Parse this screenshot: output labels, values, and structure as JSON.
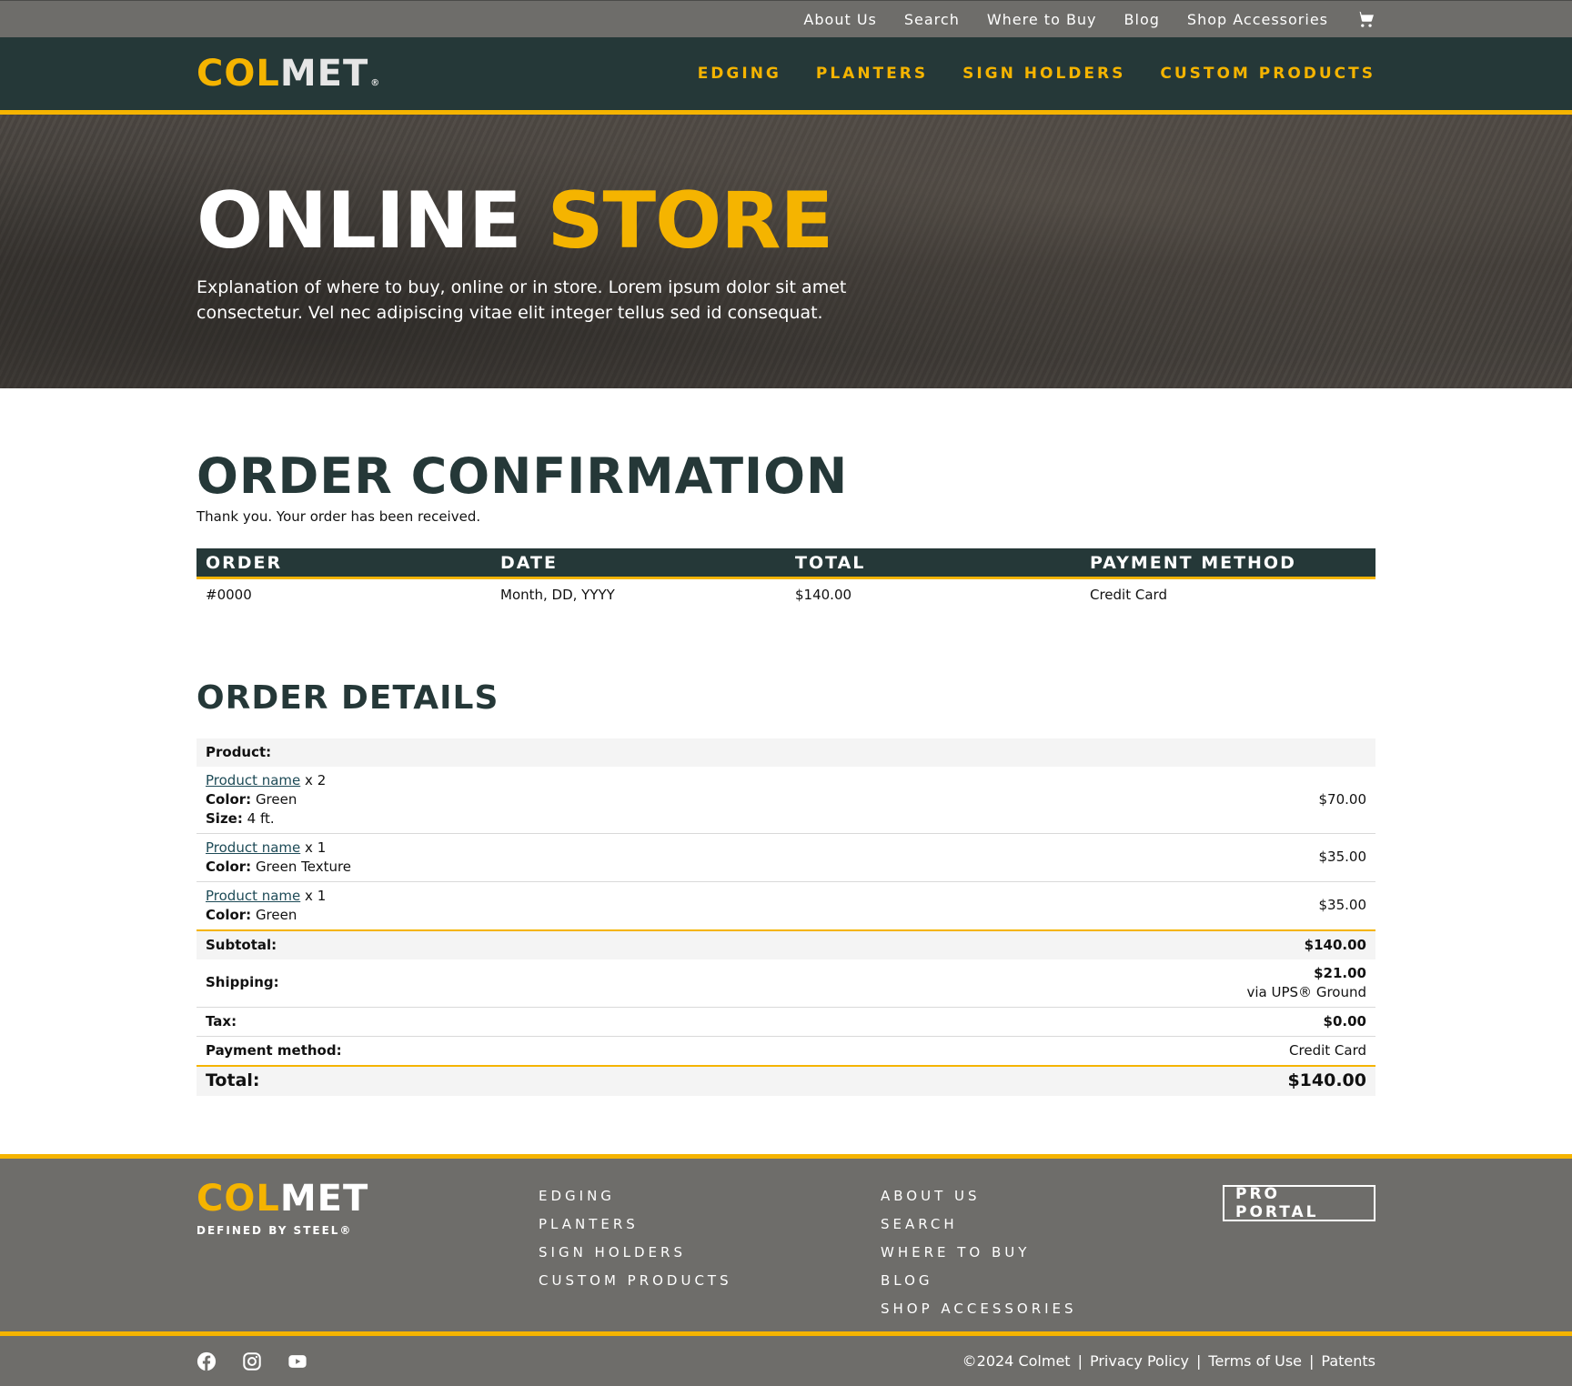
{
  "utility_nav": {
    "items": [
      "About Us",
      "Search",
      "Where to Buy",
      "Blog",
      "Shop Accessories"
    ],
    "cart_icon": "cart-icon"
  },
  "brand": {
    "logo_part1": "COL",
    "logo_part2": "MET",
    "logo_reg": "®",
    "tagline": "DEFINED BY STEEL®",
    "colors": {
      "dark": "#253838",
      "accent": "#f5b400",
      "gray": "#6e6d6a"
    }
  },
  "main_nav": {
    "items": [
      "EDGING",
      "PLANTERS",
      "SIGN HOLDERS",
      "CUSTOM PRODUCTS"
    ]
  },
  "hero": {
    "title_part1": "ONLINE",
    "title_part2": "STORE",
    "subtitle": "Explanation of where to buy, online or in store. Lorem ipsum dolor sit amet consectetur. Vel nec adipiscing vitae elit integer tellus sed id consequat."
  },
  "confirmation": {
    "title": "ORDER CONFIRMATION",
    "thanks": "Thank you. Your order has been received.",
    "columns": [
      "ORDER",
      "DATE",
      "TOTAL",
      "PAYMENT METHOD"
    ],
    "values": [
      "#0000",
      "Month, DD, YYYY",
      "$140.00",
      "Credit Card"
    ]
  },
  "details": {
    "title": "ORDER DETAILS",
    "product_header": "Product:",
    "items": [
      {
        "name": "Product name",
        "qty": "x 2",
        "color_label": "Color:",
        "color": "Green",
        "size_label": "Size:",
        "size": "4 ft.",
        "price": "$70.00"
      },
      {
        "name": "Product name",
        "qty": "x 1",
        "color_label": "Color:",
        "color": "Green Texture",
        "price": "$35.00"
      },
      {
        "name": "Product name",
        "qty": "x 1",
        "color_label": "Color:",
        "color": "Green",
        "price": "$35.00"
      }
    ],
    "subtotal_label": "Subtotal:",
    "subtotal": "$140.00",
    "shipping_label": "Shipping:",
    "shipping": "$21.00",
    "shipping_via": "via UPS® Ground",
    "tax_label": "Tax:",
    "tax": "$0.00",
    "payment_label": "Payment method:",
    "payment": "Credit Card",
    "total_label": "Total:",
    "total": "$140.00"
  },
  "footer": {
    "products": [
      "EDGING",
      "PLANTERS",
      "SIGN HOLDERS",
      "CUSTOM PRODUCTS"
    ],
    "company": [
      "ABOUT US",
      "SEARCH",
      "WHERE TO BUY",
      "BLOG",
      "SHOP ACCESSORIES"
    ],
    "pro_portal": "PRO PORTAL",
    "socials": [
      "facebook-icon",
      "instagram-icon",
      "youtube-icon"
    ],
    "copyright": "©2024 Colmet",
    "legal_links": [
      "Privacy Policy",
      "Terms of Use",
      "Patents"
    ],
    "separator": "|"
  }
}
